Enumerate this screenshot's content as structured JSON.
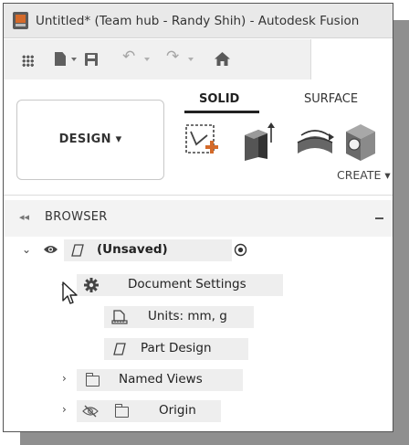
{
  "window": {
    "title": "Untitled* (Team hub - Randy Shih) - Autodesk Fusion"
  },
  "quick_access": {
    "icons": [
      "grid-icon",
      "file-icon",
      "save-icon",
      "undo-icon",
      "redo-icon",
      "home-icon"
    ]
  },
  "ribbon": {
    "workspace_label": "DESIGN ▾",
    "tabs": [
      {
        "label": "SOLID",
        "active": true
      },
      {
        "label": "SURFACE",
        "active": false
      }
    ],
    "create_label": "CREATE ▾"
  },
  "browser": {
    "title": "BROWSER",
    "root": {
      "label": "(Unsaved)"
    },
    "items": [
      {
        "label": "Document Settings",
        "icon": "gear-icon",
        "expanded": true
      },
      {
        "label": "Units: mm, g",
        "icon": "ruler-icon"
      },
      {
        "label": "Part Design",
        "icon": "box-icon"
      },
      {
        "label": "Named Views",
        "icon": "folder-icon",
        "expanded": false
      },
      {
        "label": "Origin",
        "icon": "folder-icon",
        "expanded": false,
        "hidden": true
      }
    ]
  },
  "colors": {
    "accent_orange": "#d46a2a",
    "titlebar": "#e9e9e9",
    "row_highlight": "#eeeeee"
  }
}
